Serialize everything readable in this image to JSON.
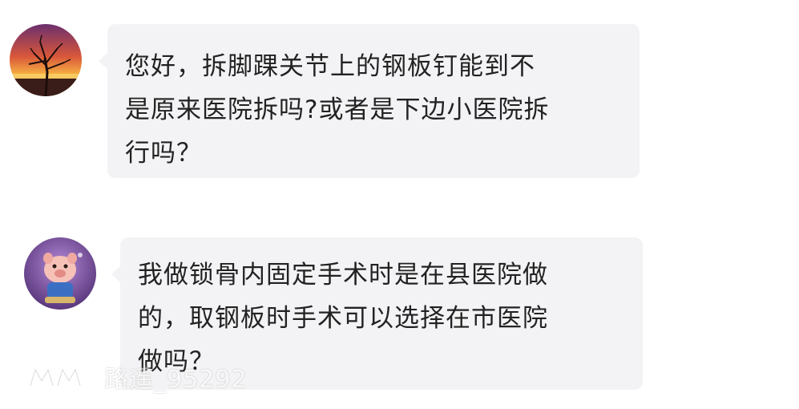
{
  "messages": [
    {
      "avatar_icon": "sunset-avatar-icon",
      "lines": [
        "您好，拆脚踝关节上的钢板钉能到不",
        "是原来医院拆吗?或者是下边小医院拆",
        "行吗？"
      ]
    },
    {
      "avatar_icon": "cartoon-pig-avatar-icon",
      "lines": [
        "我做锁骨内固定手术时是在县医院做",
        "的，取钢板时手术可以选择在市医院",
        "做吗？"
      ]
    }
  ],
  "watermark": {
    "logo_icon": "brand-logo-icon",
    "text": "路遥_95292"
  },
  "colors": {
    "bubble_bg": "#f3f3f5",
    "text": "#222222"
  }
}
